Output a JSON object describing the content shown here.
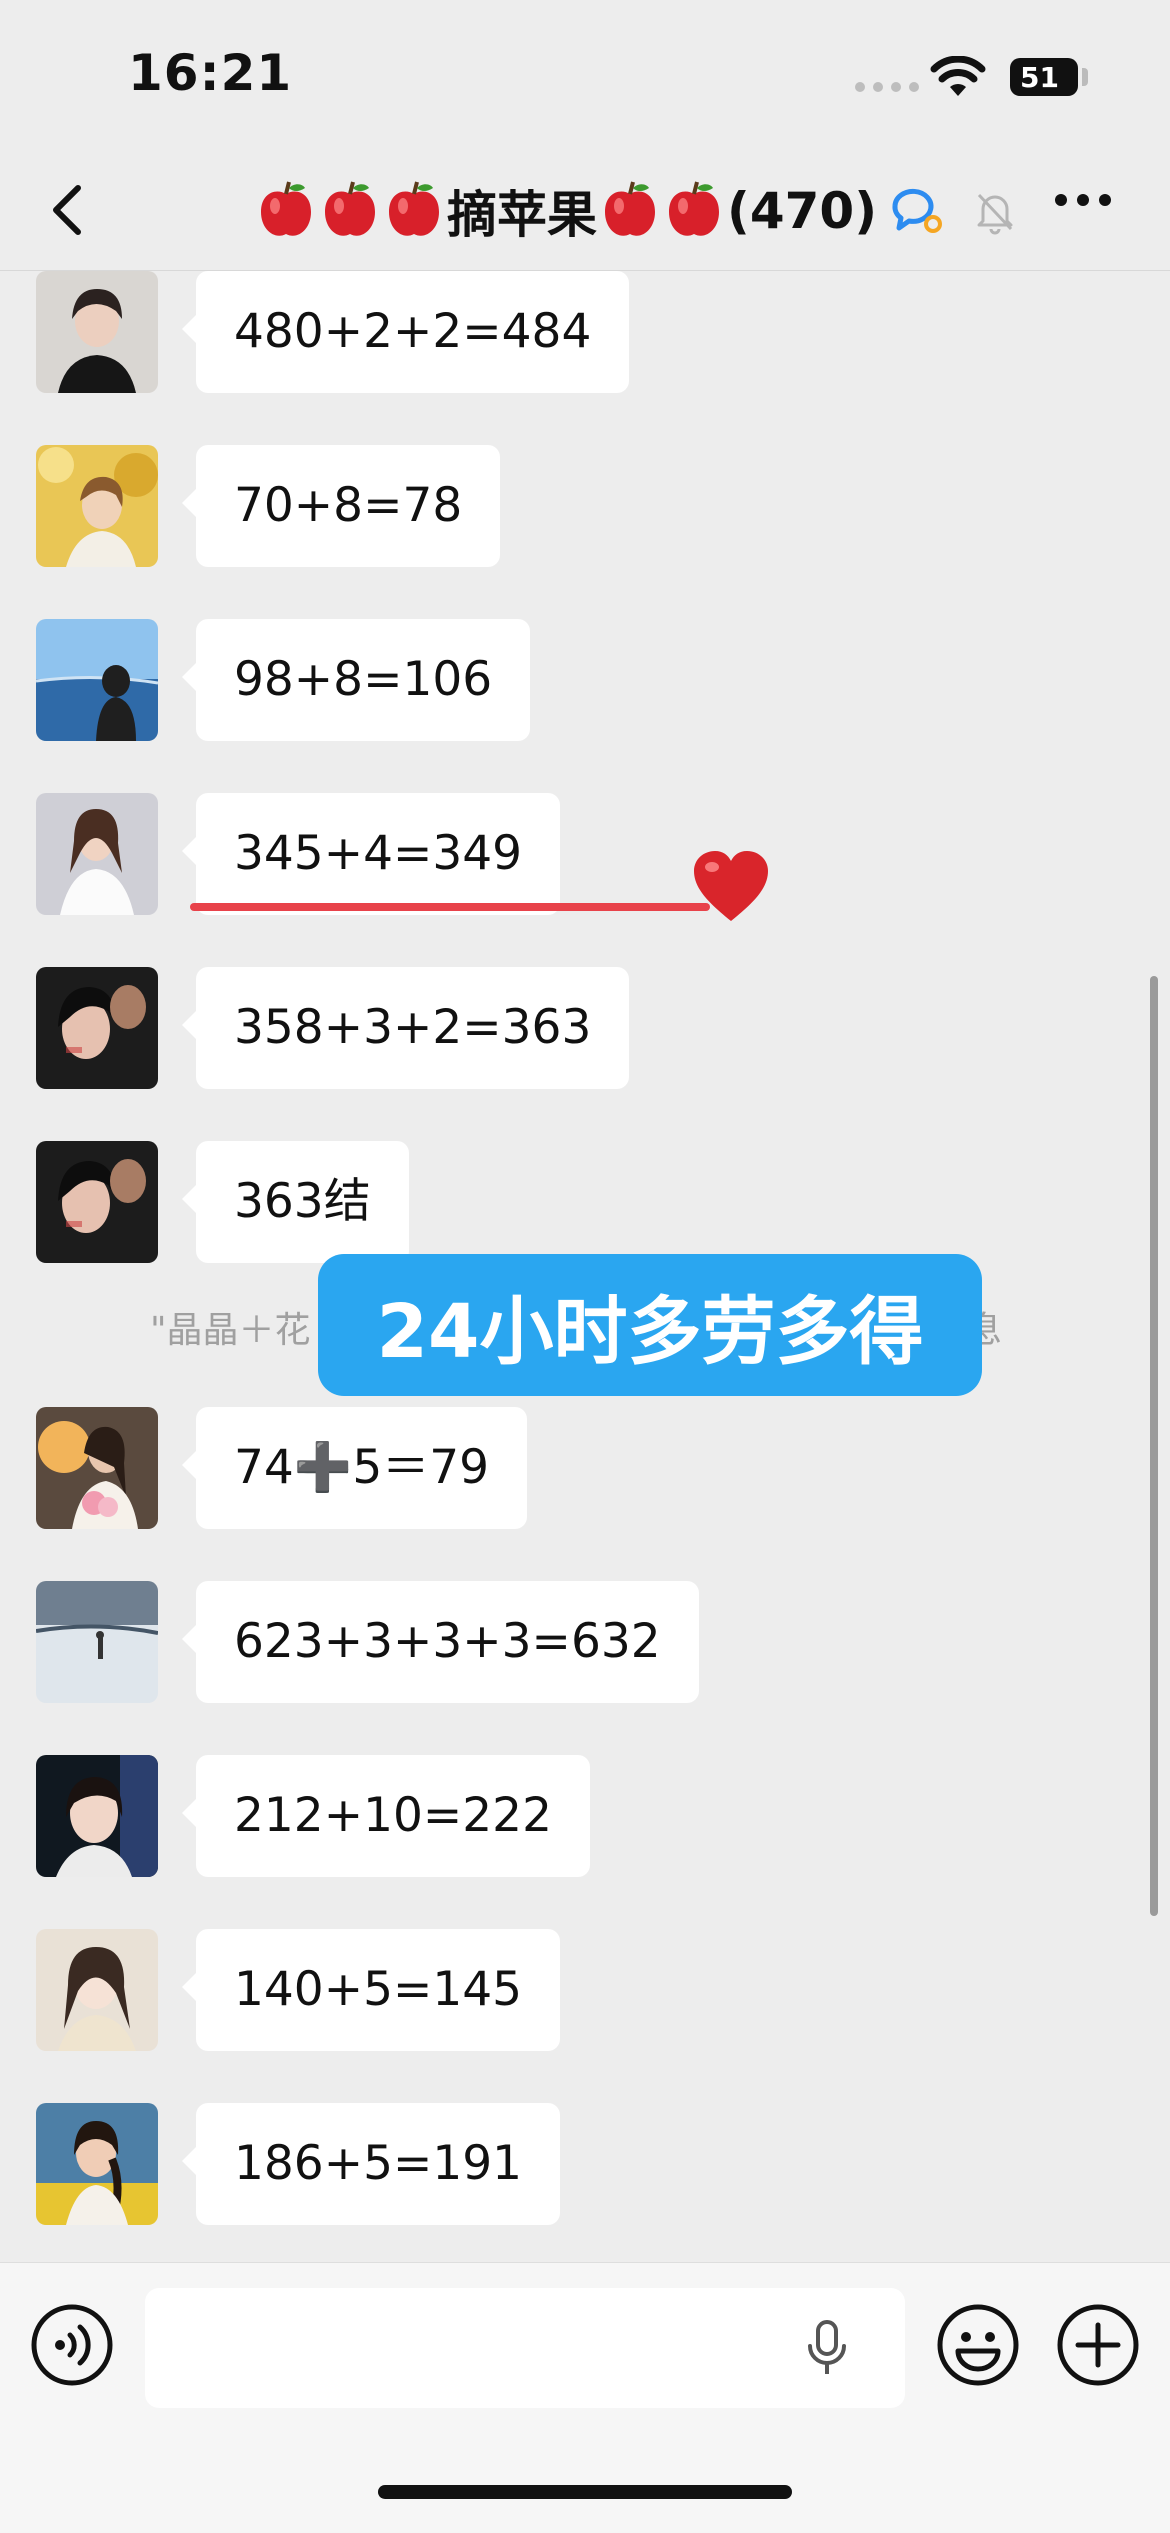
{
  "status": {
    "time": "16:21",
    "battery": "51"
  },
  "header": {
    "title": "摘苹果",
    "count": "(470)"
  },
  "messages": [
    {
      "text": "480+2+2=484",
      "avatar": "avatar-woman-black-top"
    },
    {
      "text": "70+8=78",
      "avatar": "avatar-woman-yellow-flowers"
    },
    {
      "text": "98+8=106",
      "avatar": "avatar-woman-lakeside"
    },
    {
      "text": "345+4=349",
      "avatar": "avatar-woman-white-shirt"
    },
    {
      "text": "358+3+2=363",
      "avatar": "avatar-couple-dark"
    },
    {
      "text": "363结",
      "avatar": "avatar-couple-dark"
    },
    {
      "text": "74➕5＝79",
      "avatar": "avatar-woman-sunset-flowers"
    },
    {
      "text": "623+3+3+3=632",
      "avatar": "avatar-snow-landscape"
    },
    {
      "text": "212+10=222",
      "avatar": "avatar-woman-car"
    },
    {
      "text": "140+5=145",
      "avatar": "avatar-girl-cream"
    },
    {
      "text": "186+5=191",
      "avatar": "avatar-woman-braid-field"
    }
  ],
  "system_note": {
    "start": "\"晶晶＋花",
    "end": "消息"
  },
  "banner": {
    "text": "24小时多劳多得"
  },
  "colors": {
    "background": "#ededed",
    "bubble": "#ffffff",
    "banner": "#2aa6f0",
    "underline": "#e8424a",
    "heart": "#d9252b",
    "apple": "#d8202a"
  }
}
